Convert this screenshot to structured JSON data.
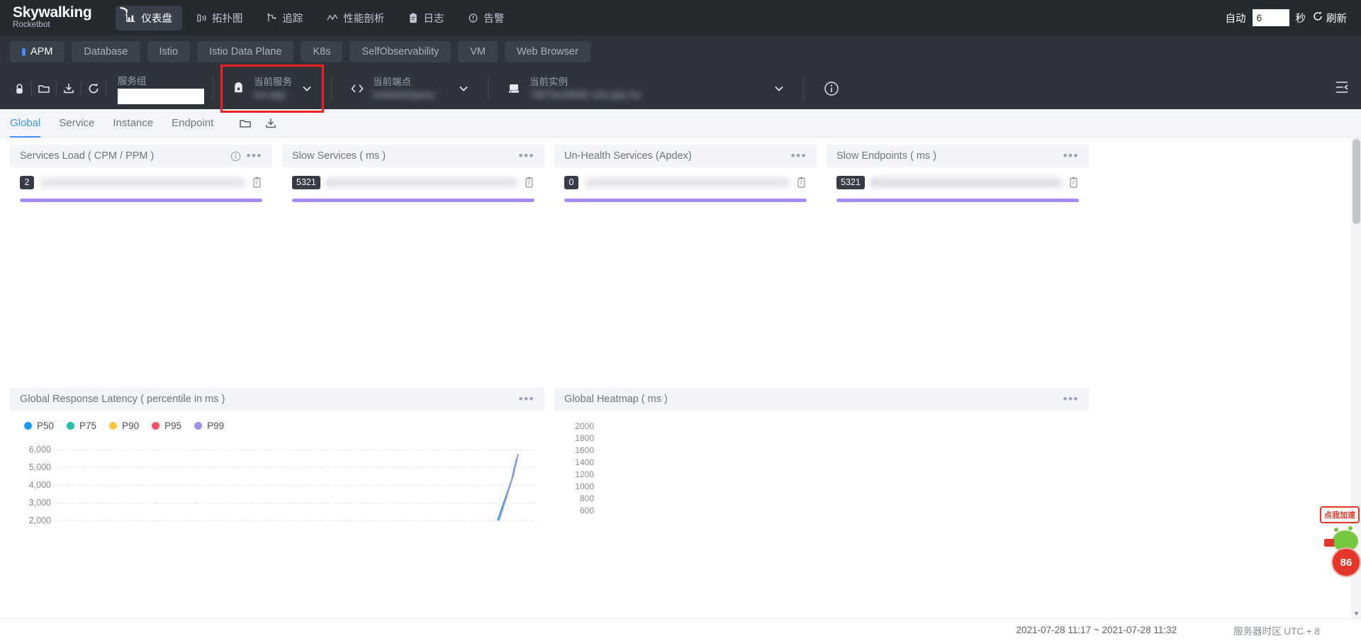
{
  "brand": {
    "name": "Skywalking",
    "sub": "Rocketbot"
  },
  "topnav": {
    "items": [
      {
        "label": "仪表盘",
        "icon": "dashboard-icon",
        "active": true
      },
      {
        "label": "拓扑图",
        "icon": "topology-icon",
        "active": false
      },
      {
        "label": "追踪",
        "icon": "trace-icon",
        "active": false
      },
      {
        "label": "性能剖析",
        "icon": "profile-icon",
        "active": false
      },
      {
        "label": "日志",
        "icon": "log-icon",
        "active": false
      },
      {
        "label": "告警",
        "icon": "alarm-icon",
        "active": false
      }
    ],
    "auto_label": "自动",
    "auto_value": "6",
    "seconds_label": "秒",
    "refresh_label": "刷新"
  },
  "tabs": [
    {
      "label": "APM",
      "active": true
    },
    {
      "label": "Database",
      "active": false
    },
    {
      "label": "Istio",
      "active": false
    },
    {
      "label": "Istio Data Plane",
      "active": false
    },
    {
      "label": "K8s",
      "active": false
    },
    {
      "label": "SelfObservability",
      "active": false
    },
    {
      "label": "VM",
      "active": false
    },
    {
      "label": "Web Browser",
      "active": false
    }
  ],
  "toolbar": {
    "icons": [
      "lock-icon",
      "folder-icon",
      "download-icon",
      "refresh-icon"
    ],
    "group": {
      "label": "服务组",
      "value": "",
      "placeholder": ""
    },
    "selectors": [
      {
        "name": "current-service",
        "icon": "service-icon",
        "label": "当前服务",
        "value": "ms-app",
        "blurred": true,
        "highlighted": true
      },
      {
        "name": "current-endpoint",
        "icon": "endpoint-icon",
        "label": "当前端点",
        "value": "ixs/base/query",
        "blurred": true,
        "highlighted": false
      },
      {
        "name": "current-instance",
        "icon": "instance-icon",
        "label": "当前实例",
        "value": "79b79c438afc.inst.app.ms",
        "blurred": true,
        "highlighted": false
      }
    ]
  },
  "subtabs": {
    "items": [
      {
        "label": "Global",
        "active": true
      },
      {
        "label": "Service",
        "active": false
      },
      {
        "label": "Instance",
        "active": false
      },
      {
        "label": "Endpoint",
        "active": false
      }
    ],
    "icons": [
      "folder-icon",
      "download-icon"
    ]
  },
  "cards": [
    {
      "title": "Services Load ( CPM / PPM )",
      "has_info": true,
      "rank": {
        "badge": "2",
        "name": "",
        "blurred": true
      },
      "bar_percent": 100,
      "bar_color": "#a78bfa"
    },
    {
      "title": "Slow Services ( ms )",
      "has_info": false,
      "rank": {
        "badge": "5321",
        "name": "i",
        "blurred": true
      },
      "bar_percent": 100,
      "bar_color": "#a78bfa"
    },
    {
      "title": "Un-Health Services (Apdex)",
      "has_info": false,
      "rank": {
        "badge": "0",
        "name": "",
        "blurred": true
      },
      "bar_percent": 100,
      "bar_color": "#a78bfa"
    },
    {
      "title": "Slow Endpoints ( ms )",
      "has_info": false,
      "rank": {
        "badge": "5321",
        "name": "i",
        "blurred": true
      },
      "bar_percent": 100,
      "bar_color": "#a78bfa"
    }
  ],
  "chart_data": [
    {
      "type": "line",
      "title": "Global Response Latency ( percentile in ms )",
      "xlabel": "",
      "ylabel": "",
      "ylim": [
        2000,
        6000
      ],
      "yticks": [
        6000,
        5000,
        4000,
        3000,
        2000
      ],
      "ytick_labels": [
        "6,000",
        "5,000",
        "4,000",
        "3,000",
        "2,000"
      ],
      "grid": true,
      "legend_position": "top-left",
      "legend": [
        {
          "name": "P50",
          "color": "#1f9bfa"
        },
        {
          "name": "P75",
          "color": "#29c0ab"
        },
        {
          "name": "P90",
          "color": "#ffc546"
        },
        {
          "name": "P95",
          "color": "#f9536b"
        },
        {
          "name": "P99",
          "color": "#9b95e8"
        }
      ],
      "series": [
        {
          "name": "P50",
          "color": "#1f9bfa",
          "values": [
            null,
            null,
            null,
            null,
            null,
            null,
            null,
            null,
            null,
            null,
            2000,
            5200
          ]
        },
        {
          "name": "P75",
          "color": "#29c0ab",
          "values": [
            null,
            null,
            null,
            null,
            null,
            null,
            null,
            null,
            null,
            null,
            2000,
            5400
          ]
        },
        {
          "name": "P90",
          "color": "#ffc546",
          "values": [
            null,
            null,
            null,
            null,
            null,
            null,
            null,
            null,
            null,
            null,
            2000,
            5400
          ]
        },
        {
          "name": "P95",
          "color": "#f9536b",
          "values": [
            null,
            null,
            null,
            null,
            null,
            null,
            null,
            null,
            null,
            null,
            2000,
            5400
          ]
        },
        {
          "name": "P99",
          "color": "#9b95e8",
          "values": [
            null,
            null,
            null,
            null,
            null,
            null,
            null,
            null,
            null,
            null,
            2000,
            5400
          ]
        }
      ]
    },
    {
      "type": "heatmap",
      "title": "Global Heatmap ( ms )",
      "xlabel": "",
      "ylabel": "",
      "yticks": [
        2000,
        1800,
        1600,
        1400,
        1200,
        1000,
        800,
        600
      ],
      "ytick_labels": [
        "2000",
        "1800",
        "1600",
        "1400",
        "1200",
        "1000",
        "800",
        "600"
      ],
      "grid": false,
      "cells": []
    }
  ],
  "footer": {
    "time_range": "2021-07-28 11:17 ~ 2021-07-28 11:32",
    "timezone": "服务器时区 UTC + 8"
  },
  "mascot": {
    "bubble": "点我加速",
    "score": "86"
  }
}
